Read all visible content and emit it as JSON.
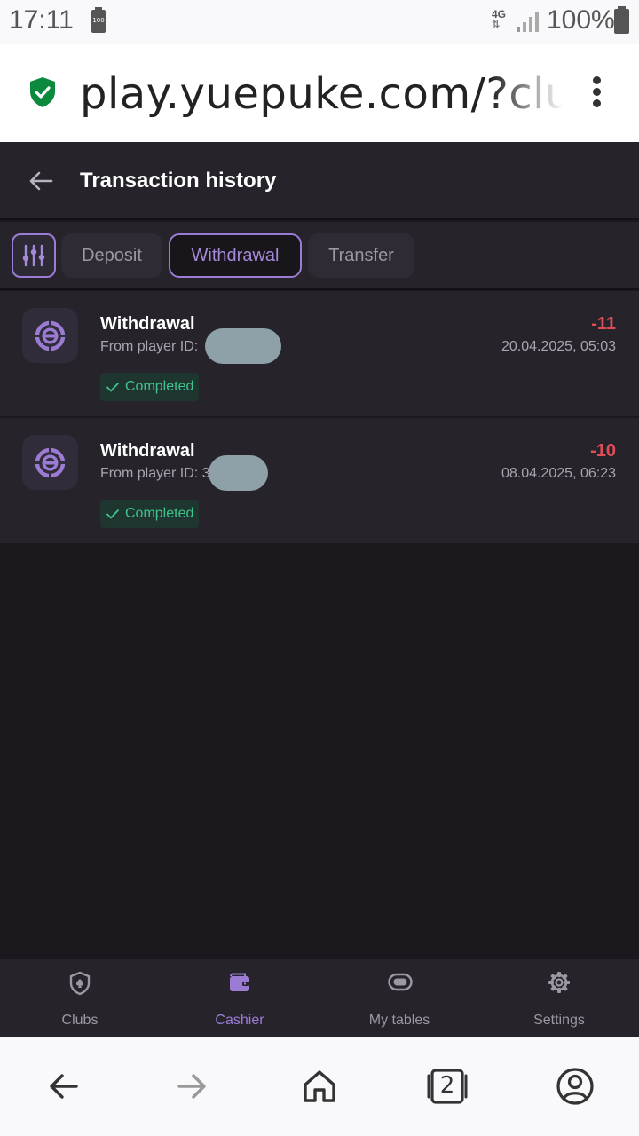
{
  "status_bar": {
    "time": "17:11",
    "battery_small_label": "100",
    "network": "4G",
    "battery_pct": "100%"
  },
  "browser": {
    "url": "play.yuepuke.com/?club"
  },
  "header": {
    "title": "Transaction history"
  },
  "filters": {
    "chips": [
      {
        "label": "Deposit",
        "active": false
      },
      {
        "label": "Withdrawal",
        "active": true
      },
      {
        "label": "Transfer",
        "active": false
      }
    ]
  },
  "transactions": [
    {
      "title": "Withdrawal",
      "subtitle": "From player ID:",
      "status": "Completed",
      "amount": "-11",
      "date": "20.04.2025, 05:03"
    },
    {
      "title": "Withdrawal",
      "subtitle": "From player ID: 3",
      "status": "Completed",
      "amount": "-10",
      "date": "08.04.2025, 06:23"
    }
  ],
  "bottom_nav": {
    "items": [
      {
        "label": "Clubs",
        "icon": "clubs-shield-icon",
        "active": false
      },
      {
        "label": "Cashier",
        "icon": "wallet-icon",
        "active": true
      },
      {
        "label": "My tables",
        "icon": "table-icon",
        "active": false
      },
      {
        "label": "Settings",
        "icon": "gear-icon",
        "active": false
      }
    ]
  },
  "system_nav": {
    "tab_count": "2"
  },
  "colors": {
    "accent": "#9b7bd4",
    "negative": "#e04d57",
    "success": "#3fc38d",
    "background": "#1b181e",
    "surface": "#26232b"
  }
}
